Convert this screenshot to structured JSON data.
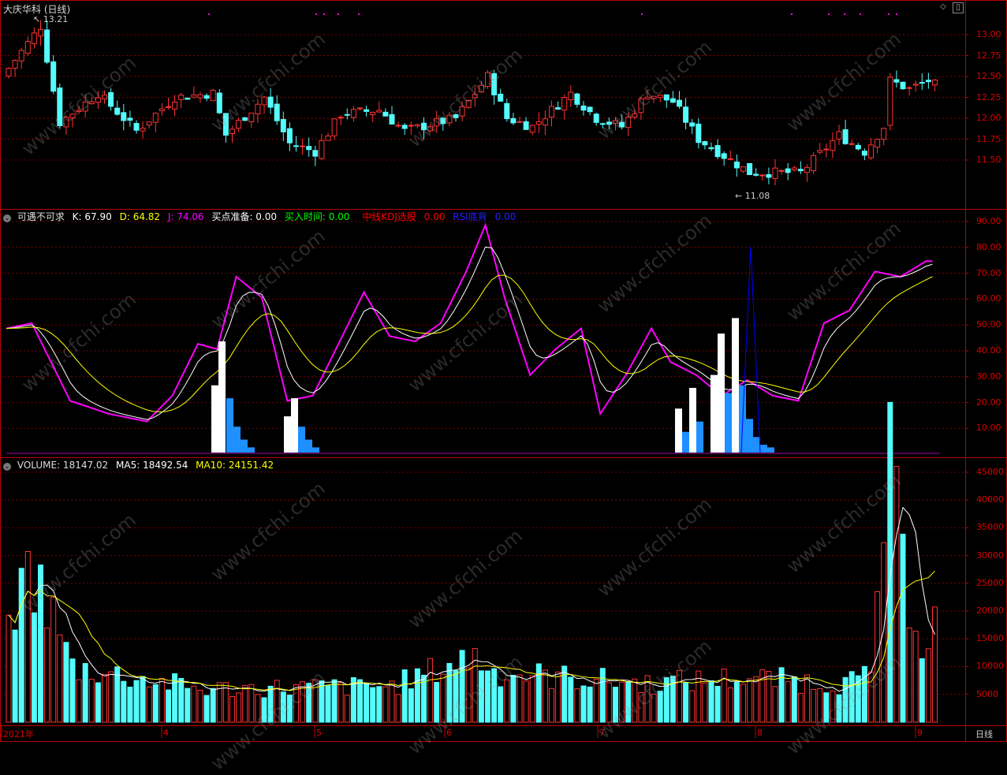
{
  "title": "大庆华科 (日线)",
  "price_panel": {
    "high_label": "13.21",
    "low_label": "11.08",
    "y_ticks": [
      "13.00",
      "12.75",
      "12.50",
      "12.25",
      "12.00",
      "11.75",
      "11.50"
    ]
  },
  "kdj_panel": {
    "name": "可遇不可求",
    "k_label": "K: 67.90",
    "d_label": "D: 64.82",
    "j_label": "J: 74.06",
    "buy_prep": "买点准备: 0.00",
    "buy_time": "买入时间: 0.00",
    "mid_kdj": "中线KDJ选股",
    "mid_kdj_val": "0.00",
    "rsi_label": "RSI底背",
    "rsi_val": "0.00",
    "y_ticks": [
      "90.00",
      "80.00",
      "70.00",
      "60.00",
      "50.00",
      "40.00",
      "30.00",
      "20.00",
      "10.00"
    ]
  },
  "volume_panel": {
    "label": "VOLUME: 18147.02",
    "ma5": "MA5: 18492.54",
    "ma10": "MA10: 24151.42",
    "y_ticks": [
      "45000",
      "40000",
      "35000",
      "30000",
      "25000",
      "20000",
      "15000",
      "10000",
      "5000"
    ]
  },
  "x_axis": {
    "labels": [
      "2021年",
      "4",
      "5",
      "6",
      "7",
      "8",
      "9"
    ],
    "period": "日线"
  },
  "watermark": "www.cfchi.com",
  "colors": {
    "up": "#ff3232",
    "down": "#54fcfc",
    "k": "#ffffff",
    "d": "#ffff00",
    "j": "#ff00ff",
    "rsi": "#0000ff"
  },
  "chart_data": {
    "type": "candlestick",
    "price_range": [
      11.08,
      13.21
    ],
    "kdj_last": {
      "K": 67.9,
      "D": 64.82,
      "J": 74.06
    },
    "volume_last": {
      "VOLUME": 18147.02,
      "MA5": 18492.54,
      "MA10": 24151.42
    }
  }
}
